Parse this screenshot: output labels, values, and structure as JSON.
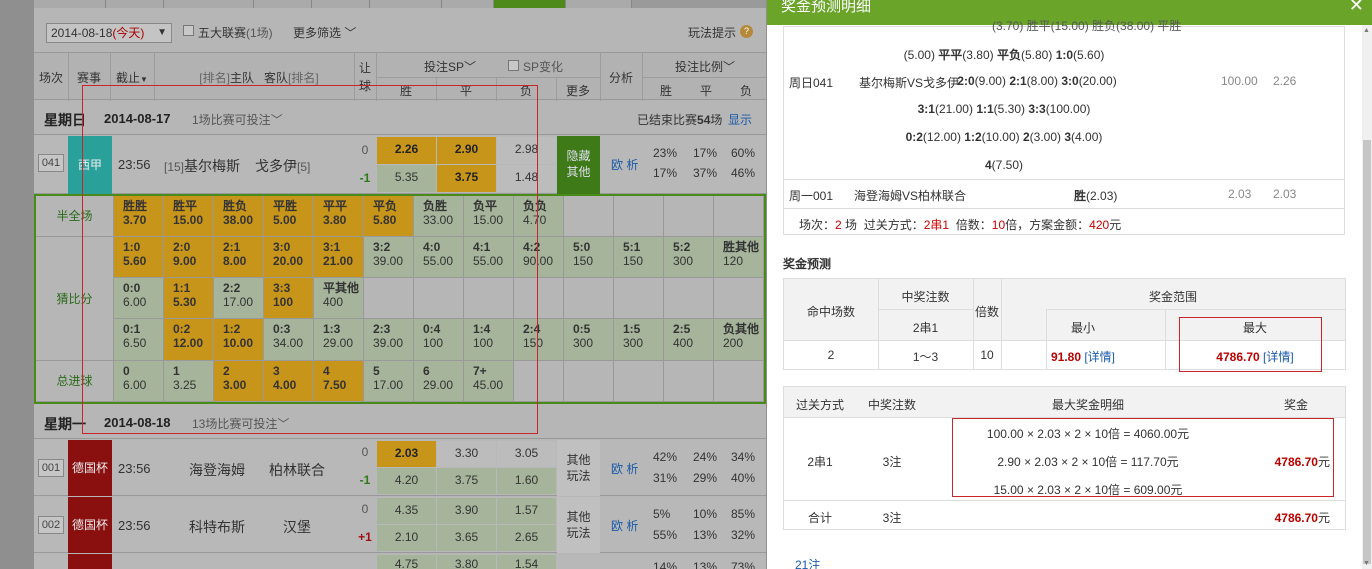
{
  "filter": {
    "date": "2014-08-18",
    "today": "(今天)",
    "five_leagues": "五大联赛",
    "five_leagues_count": "(1场)",
    "more_filter": "更多筛选",
    "play_hint": "玩法提示",
    "hint_icon": "?"
  },
  "table_header": {
    "round": "场次",
    "event": "赛事",
    "deadline": "截止",
    "rank_label_1": "[排名]",
    "home": "主队",
    "away": "客队",
    "rank_label_2": "[排名]",
    "handicap": "让球",
    "bet_sp": "投注SP",
    "sp_change": "SP变化",
    "win": "胜",
    "draw": "平",
    "lose": "负",
    "more": "更多",
    "analysis": "分析",
    "bet_ratio": "投注比例",
    "ratio_win": "胜",
    "ratio_draw": "平",
    "ratio_lose": "负"
  },
  "day1": {
    "weekday": "星期日",
    "date": "2014-08-17",
    "bettable": "1场比赛可投注",
    "ended_prefix": "已结束比赛",
    "ended_count": "54",
    "ended_suffix": "场",
    "show": "显示"
  },
  "match1": {
    "no": "041",
    "league": "西甲",
    "time": "23:56",
    "home_rank": "[15]",
    "home": "基尔梅斯",
    "away": "戈多伊",
    "away_rank": "[5]",
    "hc1": "0",
    "hc2": "-1",
    "sp1": [
      "2.26",
      "2.90",
      "2.98"
    ],
    "sp2": [
      "5.35",
      "3.75",
      "1.48"
    ],
    "more": "隐藏其他",
    "analysis_1": "欧",
    "analysis_2": "析",
    "ratio1": [
      "23%",
      "17%",
      "60%"
    ],
    "ratio2": [
      "17%",
      "37%",
      "46%"
    ]
  },
  "grid": {
    "half_full_label": "半全场",
    "score_label": "猜比分",
    "total_label": "总进球",
    "half_full": [
      {
        "k": "胜胜",
        "v": "3.70",
        "sel": true
      },
      {
        "k": "胜平",
        "v": "15.00",
        "sel": true
      },
      {
        "k": "胜负",
        "v": "38.00",
        "sel": true
      },
      {
        "k": "平胜",
        "v": "5.00",
        "sel": true
      },
      {
        "k": "平平",
        "v": "3.80",
        "sel": true
      },
      {
        "k": "平负",
        "v": "5.80",
        "sel": true
      },
      {
        "k": "负胜",
        "v": "33.00",
        "sel": false
      },
      {
        "k": "负平",
        "v": "15.00",
        "sel": false
      },
      {
        "k": "负负",
        "v": "4.70",
        "sel": false
      }
    ],
    "score_row1": [
      {
        "k": "1:0",
        "v": "5.60",
        "sel": true
      },
      {
        "k": "2:0",
        "v": "9.00",
        "sel": true
      },
      {
        "k": "2:1",
        "v": "8.00",
        "sel": true
      },
      {
        "k": "3:0",
        "v": "20.00",
        "sel": true
      },
      {
        "k": "3:1",
        "v": "21.00",
        "sel": true
      },
      {
        "k": "3:2",
        "v": "39.00",
        "sel": false
      },
      {
        "k": "4:0",
        "v": "55.00",
        "sel": false
      },
      {
        "k": "4:1",
        "v": "55.00",
        "sel": false
      },
      {
        "k": "4:2",
        "v": "90.00",
        "sel": false
      },
      {
        "k": "5:0",
        "v": "150",
        "sel": false
      },
      {
        "k": "5:1",
        "v": "150",
        "sel": false
      },
      {
        "k": "5:2",
        "v": "300",
        "sel": false
      },
      {
        "k": "胜其他",
        "v": "120",
        "sel": false
      }
    ],
    "score_row2": [
      {
        "k": "0:0",
        "v": "6.00",
        "sel": false
      },
      {
        "k": "1:1",
        "v": "5.30",
        "sel": true
      },
      {
        "k": "2:2",
        "v": "17.00",
        "sel": false
      },
      {
        "k": "3:3",
        "v": "100",
        "sel": true
      },
      {
        "k": "平其他",
        "v": "400",
        "sel": false
      }
    ],
    "score_row3": [
      {
        "k": "0:1",
        "v": "6.50",
        "sel": false
      },
      {
        "k": "0:2",
        "v": "12.00",
        "sel": true
      },
      {
        "k": "1:2",
        "v": "10.00",
        "sel": true
      },
      {
        "k": "0:3",
        "v": "34.00",
        "sel": false
      },
      {
        "k": "1:3",
        "v": "29.00",
        "sel": false
      },
      {
        "k": "2:3",
        "v": "39.00",
        "sel": false
      },
      {
        "k": "0:4",
        "v": "100",
        "sel": false
      },
      {
        "k": "1:4",
        "v": "100",
        "sel": false
      },
      {
        "k": "2:4",
        "v": "150",
        "sel": false
      },
      {
        "k": "0:5",
        "v": "300",
        "sel": false
      },
      {
        "k": "1:5",
        "v": "300",
        "sel": false
      },
      {
        "k": "2:5",
        "v": "400",
        "sel": false
      },
      {
        "k": "负其他",
        "v": "200",
        "sel": false
      }
    ],
    "total": [
      {
        "k": "0",
        "v": "6.00",
        "sel": false
      },
      {
        "k": "1",
        "v": "3.25",
        "sel": false
      },
      {
        "k": "2",
        "v": "3.00",
        "sel": true
      },
      {
        "k": "3",
        "v": "4.00",
        "sel": true
      },
      {
        "k": "4",
        "v": "7.50",
        "sel": true
      },
      {
        "k": "5",
        "v": "17.00",
        "sel": false
      },
      {
        "k": "6",
        "v": "29.00",
        "sel": false
      },
      {
        "k": "7+",
        "v": "45.00",
        "sel": false
      }
    ]
  },
  "day2": {
    "weekday": "星期一",
    "date": "2014-08-18",
    "bettable": "13场比赛可投注"
  },
  "match2": {
    "no": "001",
    "league": "德国杯",
    "time": "23:56",
    "home": "海登海姆",
    "away": "柏林联合",
    "hc1": "0",
    "hc2": "-1",
    "sp1": [
      "2.03",
      "3.30",
      "3.05"
    ],
    "sp2": [
      "4.20",
      "3.75",
      "1.60"
    ],
    "more": "其他玩法",
    "analysis_1": "欧",
    "analysis_2": "析",
    "ratio1": [
      "42%",
      "24%",
      "34%"
    ],
    "ratio2": [
      "31%",
      "29%",
      "40%"
    ]
  },
  "match3": {
    "no": "002",
    "league": "德国杯",
    "time": "23:56",
    "home": "科特布斯",
    "away": "汉堡",
    "hc1": "0",
    "hc2": "+1",
    "sp1": [
      "4.35",
      "3.90",
      "1.57"
    ],
    "sp2": [
      "2.10",
      "3.65",
      "2.65"
    ],
    "more": "其他玩法",
    "analysis_1": "欧",
    "analysis_2": "析",
    "ratio1": [
      "5%",
      "10%",
      "85%"
    ],
    "ratio2": [
      "55%",
      "13%",
      "32%"
    ]
  },
  "match4_partial": {
    "sp1": [
      "4.75",
      "3.80",
      "1.54"
    ],
    "ratio1": [
      "14%",
      "13%",
      "73%"
    ]
  },
  "modal": {
    "title": "奖金预测明细",
    "close": "✕",
    "detail": {
      "top_partial": "(3.70) 胜平(15.00) 胜负(38.00) 平胜",
      "line2": [
        {
          "t": "(5.00) ",
          "b": false
        },
        {
          "t": "平平",
          "b": true
        },
        {
          "t": "(3.80) ",
          "b": false
        },
        {
          "t": "平负",
          "b": true
        },
        {
          "t": "(5.80) ",
          "b": false
        },
        {
          "t": "1:0",
          "b": true
        },
        {
          "t": "(5.60)",
          "b": false
        }
      ],
      "m1_round": "周日041",
      "m1_teams": "基尔梅斯VS戈多伊",
      "m1_line3": [
        {
          "t": "2:0",
          "b": true
        },
        {
          "t": "(9.00) ",
          "b": false
        },
        {
          "t": "2:1",
          "b": true
        },
        {
          "t": "(8.00) ",
          "b": false
        },
        {
          "t": "3:0",
          "b": true
        },
        {
          "t": "(20.00)",
          "b": false
        }
      ],
      "m1_max": "100.00",
      "m1_min": "2.26",
      "line4": [
        {
          "t": "3:1",
          "b": true
        },
        {
          "t": "(21.00) ",
          "b": false
        },
        {
          "t": "1:1",
          "b": true
        },
        {
          "t": "(5.30) ",
          "b": false
        },
        {
          "t": "3:3",
          "b": true
        },
        {
          "t": "(100.00)",
          "b": false
        }
      ],
      "line5": [
        {
          "t": "0:2",
          "b": true
        },
        {
          "t": "(12.00) ",
          "b": false
        },
        {
          "t": "1:2",
          "b": true
        },
        {
          "t": "(10.00) ",
          "b": false
        },
        {
          "t": "2",
          "b": true
        },
        {
          "t": "(3.00) ",
          "b": false
        },
        {
          "t": "3",
          "b": true
        },
        {
          "t": "(4.00)",
          "b": false
        }
      ],
      "line6": [
        {
          "t": "4",
          "b": true
        },
        {
          "t": "(7.50)",
          "b": false
        }
      ],
      "m2_round": "周一001",
      "m2_teams": "海登海姆VS柏林联合",
      "m2_pick_b": "胜",
      "m2_pick": "(2.03)",
      "m2_max": "2.03",
      "m2_min": "2.03",
      "sum_rounds_l": "场次：",
      "sum_rounds": "2",
      "sum_rounds_u": "场",
      "sum_pass_l": "过关方式：",
      "sum_pass": "2串1",
      "sum_mult_l": "倍数：",
      "sum_mult": "10",
      "sum_mult_u": "倍，方案金额：",
      "sum_amount": "420",
      "sum_amount_u": "元"
    },
    "predict": {
      "title": "奖金预测",
      "h_hits": "命中场数",
      "h_notes": "中奖注数",
      "h_pass": "2串1",
      "h_mult": "倍数",
      "h_range": "奖金范围",
      "h_min": "最小",
      "h_max": "最大",
      "r_hits": "2",
      "r_notes": "1～3",
      "r_mult": "10",
      "r_min": "91.80",
      "r_min_link": "[详情]",
      "r_max": "4786.70",
      "r_max_link": "[详情]"
    },
    "max_detail": {
      "h_pass": "过关方式",
      "h_notes": "中奖注数",
      "h_detail": "最大奖金明细",
      "h_prize": "奖金",
      "pass": "2串1",
      "notes": "3注",
      "lines": [
        "100.00 × 2.03 × 2 × 10倍 = 4060.00元",
        "2.90 × 2.03 × 2 × 10倍 = 117.70元",
        "15.00 × 2.03 × 2 × 10倍 = 609.00元"
      ],
      "prize": "4786.70",
      "prize_unit": "元",
      "total_label": "合计",
      "total_notes": "3注",
      "total": "4786.70",
      "total_unit": "元"
    },
    "partial_bottom": "21注"
  }
}
